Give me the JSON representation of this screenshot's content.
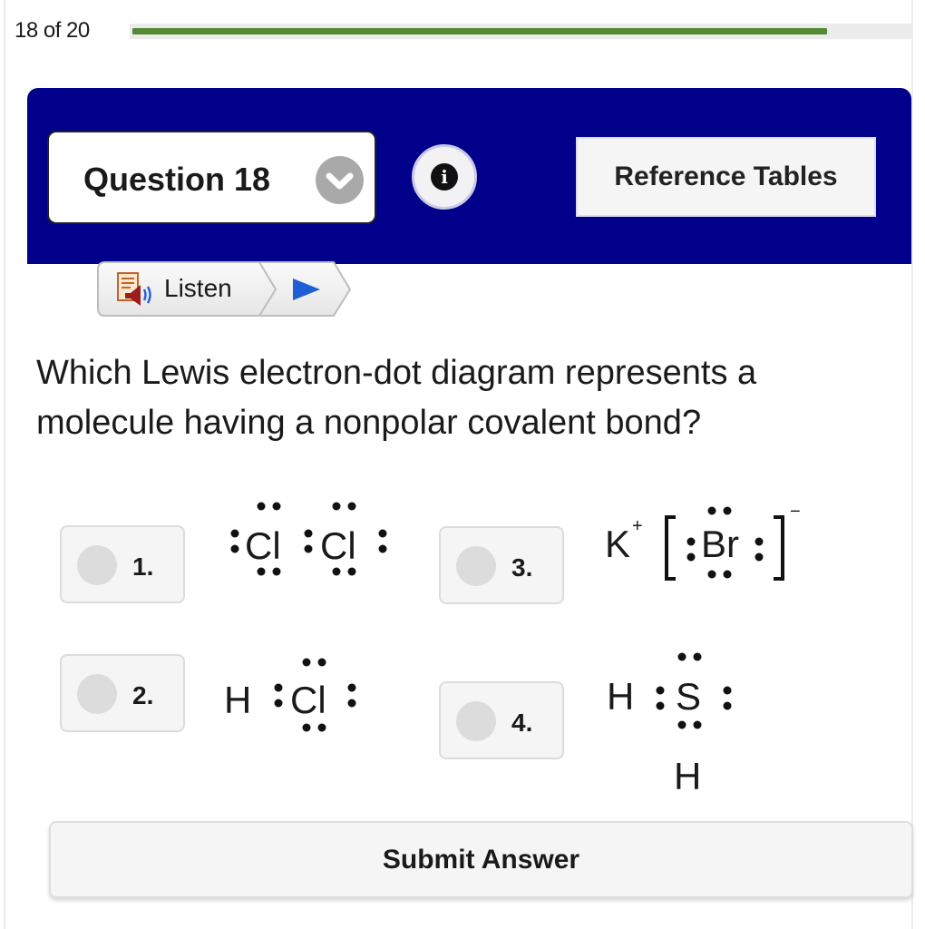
{
  "progress": {
    "label": "18 of 20",
    "current": 18,
    "total": 20,
    "fraction": 0.9,
    "fill_color": "#538a32"
  },
  "header": {
    "background_color": "#00008b",
    "question_selector": {
      "label": "Question 18",
      "icon": "chevron-down-icon"
    },
    "info_button": {
      "glyph": "i",
      "icon": "info-icon"
    },
    "reference_button": {
      "label": "Reference Tables"
    }
  },
  "listen": {
    "label": "Listen",
    "icons": [
      "document-speaker-icon",
      "play-icon"
    ]
  },
  "question": {
    "text": "Which Lewis electron-dot diagram represents a molecule having a nonpolar covalent bond?"
  },
  "options": [
    {
      "number": "1.",
      "diagram": ":Cl:Cl: (Cl2, each Cl with 3 lone pairs, one shared pair)",
      "atoms": [
        "Cl",
        "Cl"
      ]
    },
    {
      "number": "2.",
      "diagram": "H:Cl: (HCl, Cl with 3 lone pairs)",
      "atoms": [
        "H",
        "Cl"
      ]
    },
    {
      "number": "3.",
      "diagram": "K+ [:Br:]- (ionic KBr)",
      "atoms": [
        "K",
        "Br"
      ],
      "cation_charge": "+",
      "anion_charge": "−"
    },
    {
      "number": "4.",
      "diagram": "H:S: with H below (H2S)",
      "atoms": [
        "H",
        "S",
        "H"
      ]
    }
  ],
  "submit": {
    "label": "Submit Answer"
  }
}
